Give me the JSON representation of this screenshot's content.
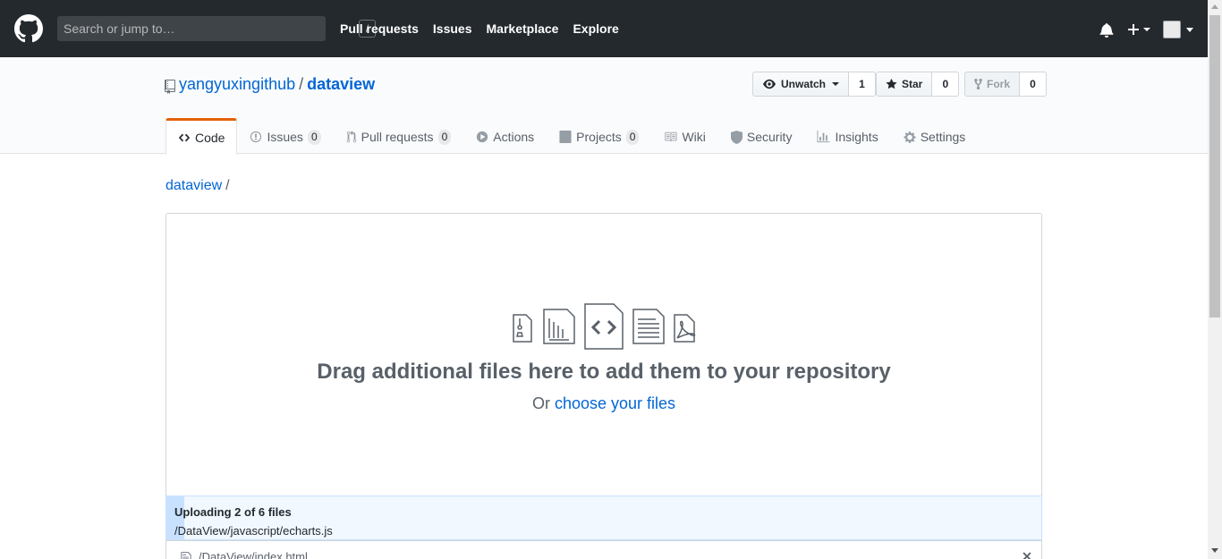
{
  "header": {
    "search_placeholder": "Search or jump to…",
    "search_shortcut": "/",
    "nav": [
      "Pull requests",
      "Issues",
      "Marketplace",
      "Explore"
    ]
  },
  "repo": {
    "owner": "yangyuxingithub",
    "separator": "/",
    "name": "dataview",
    "watch_label": "Unwatch",
    "watch_count": "1",
    "star_label": "Star",
    "star_count": "0",
    "fork_label": "Fork",
    "fork_count": "0"
  },
  "tabs": [
    {
      "label": "Code",
      "icon": "code-icon",
      "selected": true
    },
    {
      "label": "Issues",
      "icon": "issue-opened-icon",
      "counter": "0"
    },
    {
      "label": "Pull requests",
      "icon": "git-pull-request-icon",
      "counter": "0"
    },
    {
      "label": "Actions",
      "icon": "play-icon"
    },
    {
      "label": "Projects",
      "icon": "project-icon",
      "counter": "0"
    },
    {
      "label": "Wiki",
      "icon": "book-icon"
    },
    {
      "label": "Security",
      "icon": "shield-icon"
    },
    {
      "label": "Insights",
      "icon": "graph-icon"
    },
    {
      "label": "Settings",
      "icon": "gear-icon"
    }
  ],
  "breadcrumb": {
    "root": "dataview",
    "sep": "/"
  },
  "dropzone": {
    "title": "Drag additional files here to add them to your repository",
    "or_text": "Or",
    "choose_link": "choose your files",
    "file_type_icons": [
      "file-zip-icon",
      "file-media-icon",
      "file-code-icon",
      "file-text-icon",
      "file-pdf-icon"
    ]
  },
  "upload": {
    "status": "Uploading 2 of 6 files",
    "current_file": "/DataView/javascript/echarts.js",
    "progress": 0.02
  },
  "files": [
    {
      "name": "/DataView/index.html"
    }
  ],
  "colors": {
    "header_bg": "#24292e",
    "link": "#0366d6",
    "tab_accent": "#e36209",
    "progress_bg": "#f1f8ff",
    "progress_fill": "#c8e1ff"
  }
}
